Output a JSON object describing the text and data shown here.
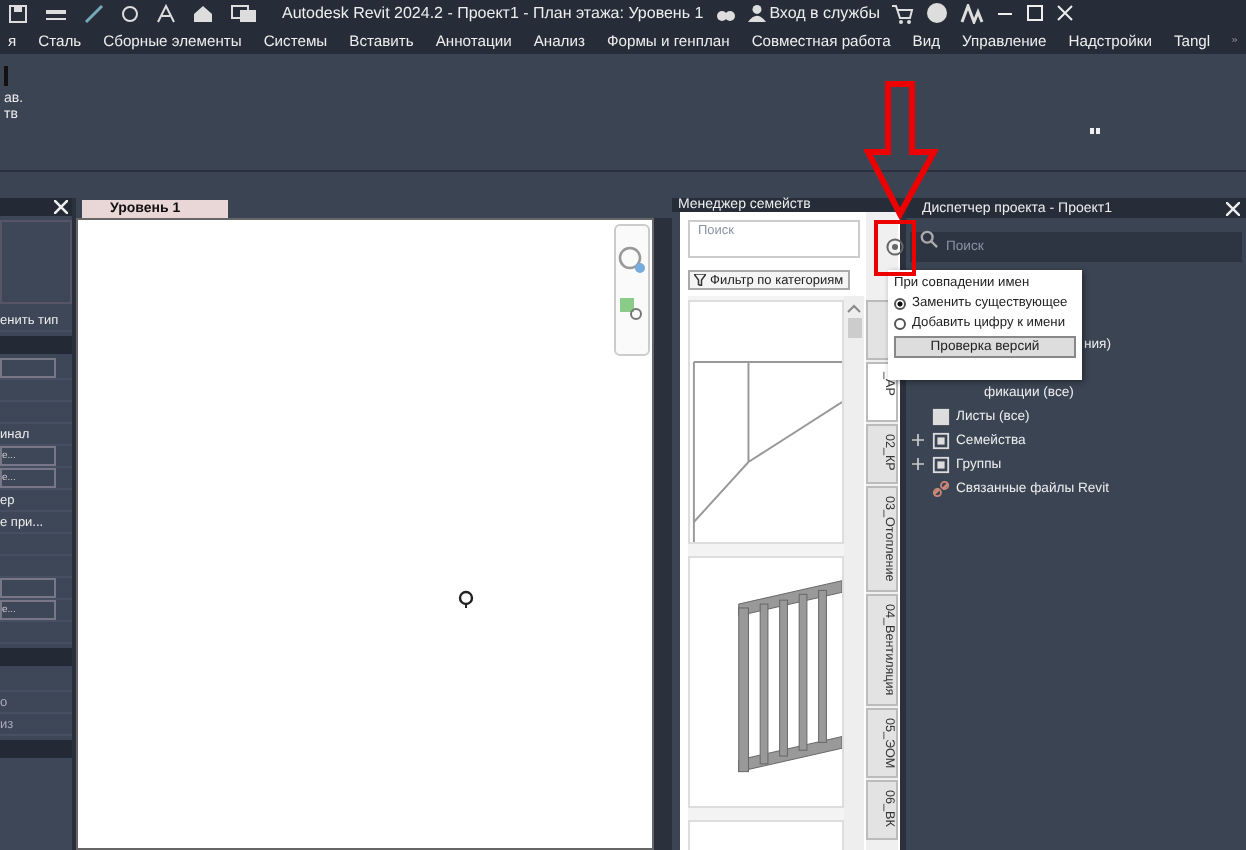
{
  "title_bar": {
    "title": "Autodesk Revit 2024.2 - Проект1 - План этажа: Уровень 1",
    "sign_in": "Вход в службы"
  },
  "menu": [
    {
      "label": "я"
    },
    {
      "label": "Сталь"
    },
    {
      "label": "Сборные элементы"
    },
    {
      "label": "Системы"
    },
    {
      "label": "Вставить"
    },
    {
      "label": "Аннотации"
    },
    {
      "label": "Анализ"
    },
    {
      "label": "Формы и генплан"
    },
    {
      "label": "Совместная работа"
    },
    {
      "label": "Вид"
    },
    {
      "label": "Управление"
    },
    {
      "label": "Надстройки"
    },
    {
      "label": "Tangl"
    }
  ],
  "ribbon": {
    "labels": [
      "ав.",
      "тв"
    ]
  },
  "properties": {
    "rows": [
      {
        "kind": "text",
        "text": "енить тип"
      },
      {
        "kind": "header"
      },
      {
        "kind": "field"
      },
      {
        "kind": "blank"
      },
      {
        "kind": "blank"
      },
      {
        "kind": "text",
        "text": "инал"
      },
      {
        "kind": "field",
        "text": "е..."
      },
      {
        "kind": "field",
        "text": "е..."
      },
      {
        "kind": "text",
        "text": "ер"
      },
      {
        "kind": "text",
        "text": "е при..."
      },
      {
        "kind": "blank"
      },
      {
        "kind": "blank"
      },
      {
        "kind": "field"
      },
      {
        "kind": "field",
        "text": "е..."
      },
      {
        "kind": "blank"
      },
      {
        "kind": "header"
      },
      {
        "kind": "blank"
      },
      {
        "kind": "dim",
        "text": "о"
      },
      {
        "kind": "dim",
        "text": "из"
      },
      {
        "kind": "header"
      }
    ]
  },
  "view": {
    "tabs": [
      {
        "label": "Уровень 1",
        "selected": true
      }
    ]
  },
  "family_manager": {
    "title": "Менеджер семейств",
    "search": {
      "placeholder": "Поиск"
    },
    "filter": "Фильтр по категориям",
    "category_tabs": [
      {
        "selected": false
      },
      {
        "label": "_АР",
        "selected": true
      },
      {
        "label": "02_КР",
        "selected": false
      },
      {
        "label": "03_Отопление",
        "selected": false
      },
      {
        "label": "04_Вентиляция",
        "selected": false
      },
      {
        "label": "05_ЭОМ",
        "selected": false
      },
      {
        "label": "06_ВК",
        "selected": false
      }
    ]
  },
  "project_browser": {
    "title": "Диспетчер проекта - Проект1",
    "search": {
      "placeholder": "Поиск"
    },
    "items": [
      {
        "kind": "hidden"
      },
      {
        "kind": "hidden"
      },
      {
        "kind": "hidden"
      },
      {
        "kind": "partial",
        "text": "ния)"
      },
      {
        "kind": "hidden"
      },
      {
        "kind": "partial2",
        "text": "фикации (все)"
      },
      {
        "kind": "sheet",
        "text": "Листы (все)",
        "expandable": false
      },
      {
        "kind": "family",
        "text": "Семейства",
        "expandable": true
      },
      {
        "kind": "group",
        "text": "Группы",
        "expandable": true
      },
      {
        "kind": "link",
        "text": "Связанные файлы Revit",
        "expandable": false
      }
    ]
  },
  "popup": {
    "heading": "При совпадении имен",
    "options": [
      {
        "label": "Заменить существующее",
        "selected": true
      },
      {
        "label": "Добавить цифру к имени",
        "selected": false
      }
    ],
    "button": "Проверка версий"
  }
}
